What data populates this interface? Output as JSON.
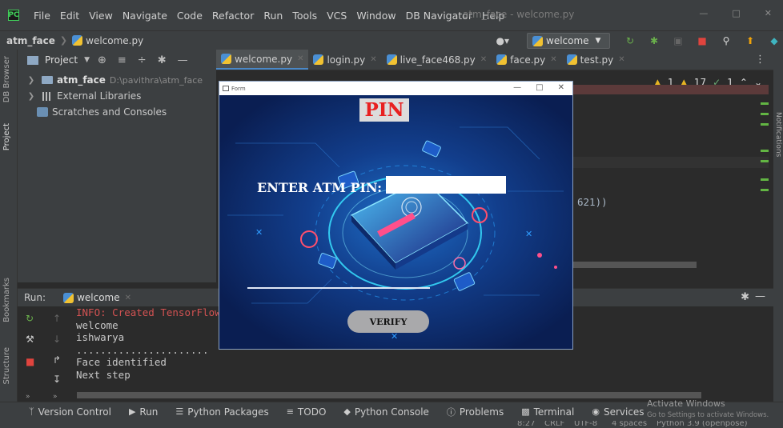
{
  "menubar": {
    "items": [
      "File",
      "Edit",
      "View",
      "Navigate",
      "Code",
      "Refactor",
      "Run",
      "Tools",
      "VCS",
      "Window",
      "DB Navigator",
      "Help"
    ],
    "window_title": "atm_face - welcome.py"
  },
  "navbar": {
    "project": "atm_face",
    "file": "welcome.py",
    "run_config": "welcome"
  },
  "left_stripe": {
    "db_browser": "DB Browser",
    "project": "Project",
    "bookmarks": "Bookmarks",
    "structure": "Structure"
  },
  "right_stripe": {
    "notifications": "Notifications"
  },
  "project_panel": {
    "title": "Project",
    "tree": [
      {
        "label": "atm_face",
        "path": "D:\\pavithra\\atm_face"
      },
      {
        "label": "External Libraries"
      },
      {
        "label": "Scratches and Consoles"
      }
    ]
  },
  "editor_tabs": [
    {
      "label": "welcome.py",
      "active": true
    },
    {
      "label": "login.py"
    },
    {
      "label": "live_face468.py"
    },
    {
      "label": "face.py"
    },
    {
      "label": "test.py"
    }
  ],
  "inspections": {
    "warnings_a": "1",
    "warnings_b": "17",
    "weak": "1"
  },
  "editor": {
    "visible_code": "621))"
  },
  "run_panel": {
    "label": "Run:",
    "tab": "welcome",
    "console": {
      "info_line": "INFO: Created TensorFlow",
      "lines": [
        "welcome",
        "ishwarya",
        "......................",
        "Face identified",
        "Next step"
      ]
    }
  },
  "bottom_toolbar": [
    "Version Control",
    "Run",
    "Python Packages",
    "TODO",
    "Python Console",
    "Problems",
    "Terminal",
    "Services"
  ],
  "activate_windows": {
    "title": "Activate Windows",
    "subtitle": "Go to Settings to activate Windows."
  },
  "status_bar": {
    "position": "8:27",
    "line_sep": "CRLF",
    "encoding": "UTF-8",
    "indent": "4 spaces",
    "interpreter": "Python 3.9 (openpose)"
  },
  "form_window": {
    "title": "Form",
    "pin_heading": "PIN",
    "pin_label": "ENTER ATM PIN:",
    "pin_value": "",
    "verify_label": "VERIFY",
    "colors": {
      "heading": "#e82020",
      "button": "#a9a9ab"
    }
  }
}
